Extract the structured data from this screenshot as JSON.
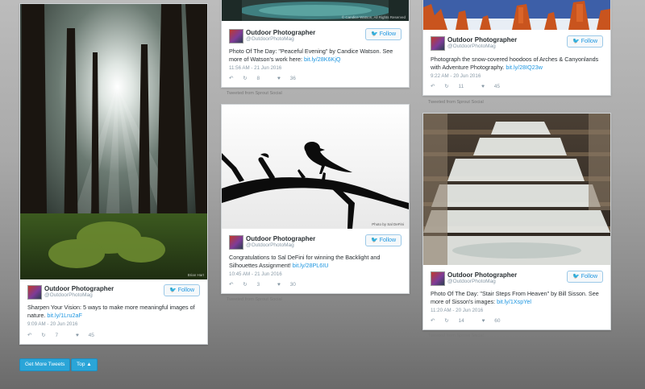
{
  "tweets": [
    {
      "name": "Outdoor Photographer",
      "handle": "@OutdoorPhotoMag",
      "follow": "Follow",
      "text": "Sharpen Your Vision: 5 ways to make more meaningful images of nature.",
      "link": "bit.ly/1Lru2aF",
      "time": "9:09 AM - 20 Jun 2016",
      "retweets": "7",
      "likes": "45",
      "photo_watermark": "Brian Hart"
    },
    {
      "name": "Outdoor Photographer",
      "handle": "@OutdoorPhotoMag",
      "follow": "Follow",
      "text": "Photo Of The Day: \"Peaceful Evening\" by Candice Watson. See more of Watson's work here:",
      "link": "bit.ly/28K6KjQ",
      "time": "11:56 AM - 21 Jun 2016",
      "retweets": "8",
      "likes": "36",
      "photo_watermark": "© Candice Watson, All Rights Reserved"
    },
    {
      "name": "Outdoor Photographer",
      "handle": "@OutdoorPhotoMag",
      "follow": "Follow",
      "text": "Congratulations to Sal DeFini for winning the Backlight and Silhouettes Assignment!",
      "link": "bit.ly/28PL6IU",
      "time": "10:45 AM - 21 Jun 2016",
      "retweets": "3",
      "likes": "30",
      "photo_watermark": "Photo by Sal DeFini"
    },
    {
      "name": "Outdoor Photographer",
      "handle": "@OutdoorPhotoMag",
      "follow": "Follow",
      "text": "Photograph the snow-covered hoodoos of Arches & Canyonlands with Adventure Photography.",
      "link": "bit.ly/28IQ23w",
      "time": "9:22 AM - 20 Jun 2016",
      "retweets": "11",
      "likes": "45"
    },
    {
      "name": "Outdoor Photographer",
      "handle": "@OutdoorPhotoMag",
      "follow": "Follow",
      "text": "Photo Of The Day: \"Stair Steps From Heaven\" by Bill Sisson. See more of Sisson's images:",
      "link": "bit.ly/1XspYel",
      "time": "11:20 AM - 20 Jun 2016",
      "retweets": "14",
      "likes": "60"
    }
  ],
  "credit": "Tweeted from Sprout Social",
  "buttons": {
    "more": "Get More Tweets",
    "top": "Top ▲"
  },
  "icons": {
    "reply": "↶",
    "retweet": "↻",
    "like": "♥",
    "bird": "🐦"
  }
}
